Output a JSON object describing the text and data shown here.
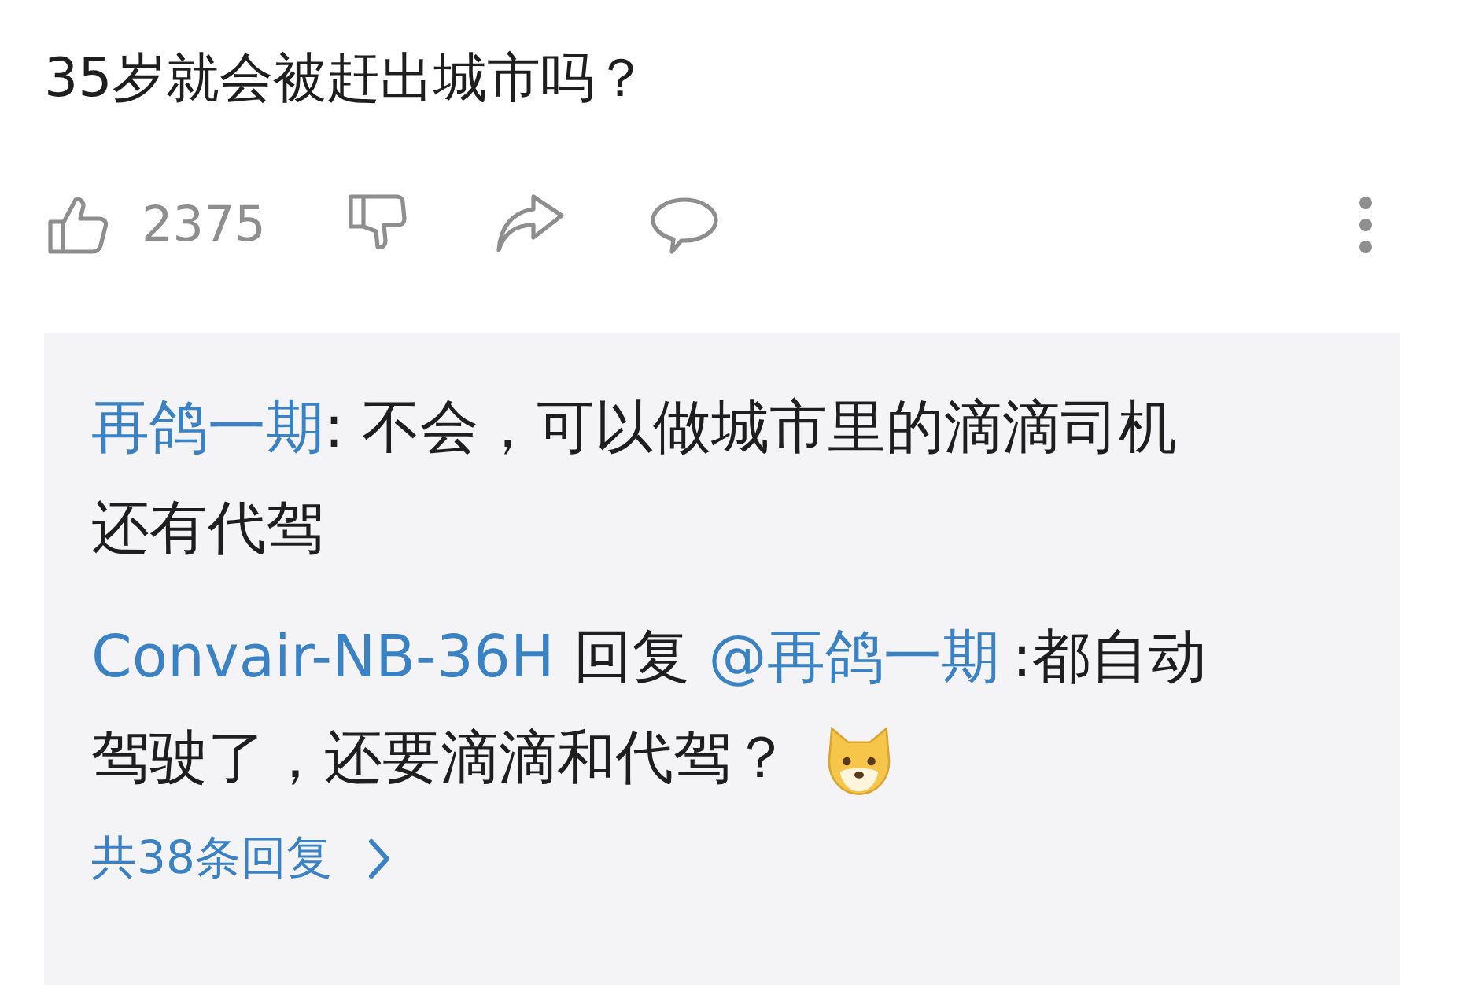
{
  "post": {
    "title": "35岁就会被赶出城市吗？"
  },
  "actions": [
    {
      "kind": "like",
      "count": "2375"
    },
    {
      "kind": "dislike"
    },
    {
      "kind": "share"
    },
    {
      "kind": "comment"
    }
  ],
  "replies": [
    {
      "author": "再鸽一期",
      "text": ": 不会，可以做城市里的滴滴司机还有代驾"
    },
    {
      "author": "Convair-NB-36H",
      "reply_label": "回复",
      "reply_to": "@再鸽一期",
      "text": ":都自动驾驶了，还要滴滴和代驾？",
      "sticker": {
        "kind": "dog"
      }
    }
  ],
  "more_replies": {
    "label": "共38条回复"
  }
}
